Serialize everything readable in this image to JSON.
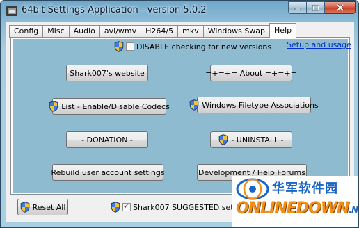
{
  "window": {
    "title": "64bit Settings Application - version 5.0.2"
  },
  "tabs": [
    "Config",
    "Misc",
    "Audio",
    "avi/wmv",
    "H264/5",
    "mkv",
    "Windows Swap",
    "Help"
  ],
  "active_tab": "Help",
  "help": {
    "disable_check": {
      "label": "DISABLE checking for new versions",
      "checked": false
    },
    "setup_link": "Setup and usage",
    "buttons": {
      "website": "Shark007's website",
      "about": "=+=+= About =+=+=",
      "codecs": "List - Enable/Disable Codecs",
      "associations": "Windows Filetype Associations",
      "donation": "- DONATION -",
      "uninstall": "- UNINSTALL -",
      "rebuild": "Rebuild user account settings",
      "forums": "Development / Help Forums"
    }
  },
  "footer": {
    "reset": "Reset All",
    "suggested": {
      "label": "Shark007 SUGGESTED settings",
      "checked": true
    }
  },
  "watermark": {
    "line1": "华军软件园",
    "line2": "ONLINEDOWN",
    "line2_suffix": ".NET"
  },
  "colors": {
    "panel_bg": "#8fbbd1",
    "link": "#0033cc",
    "close_button": "#c63a22"
  }
}
